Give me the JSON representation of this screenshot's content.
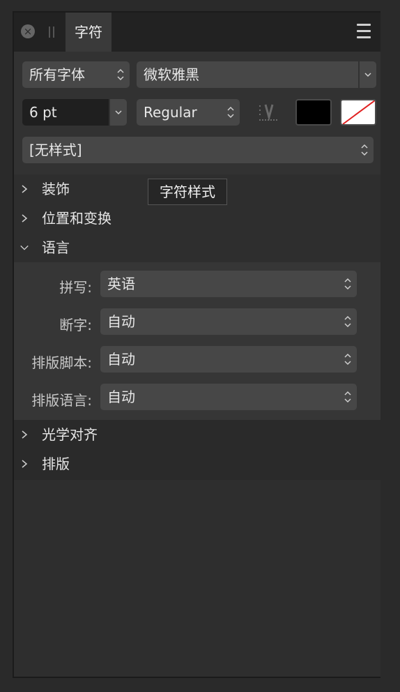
{
  "panel": {
    "tab_label": "字符",
    "icons": {
      "close": "close-icon",
      "grip": "drag-grip-icon",
      "menu": "hamburger-menu-icon"
    }
  },
  "font": {
    "collection": "所有字体",
    "family": "微软雅黑",
    "size": "6 pt",
    "style": "Regular",
    "paragraph_style": "[无样式]",
    "fill_color": "#000000",
    "stroke_color": "none"
  },
  "sections": {
    "decoration": "装饰",
    "position_transform": "位置和变换",
    "language": "语言",
    "optical_alignment": "光学对齐",
    "typography": "排版"
  },
  "language": {
    "spelling_label": "拼写:",
    "spelling_value": "英语",
    "hyphenation_label": "断字:",
    "hyphenation_value": "自动",
    "script_label": "排版脚本:",
    "script_value": "自动",
    "typo_lang_label": "排版语言:",
    "typo_lang_value": "自动"
  },
  "tooltip": "字符样式"
}
